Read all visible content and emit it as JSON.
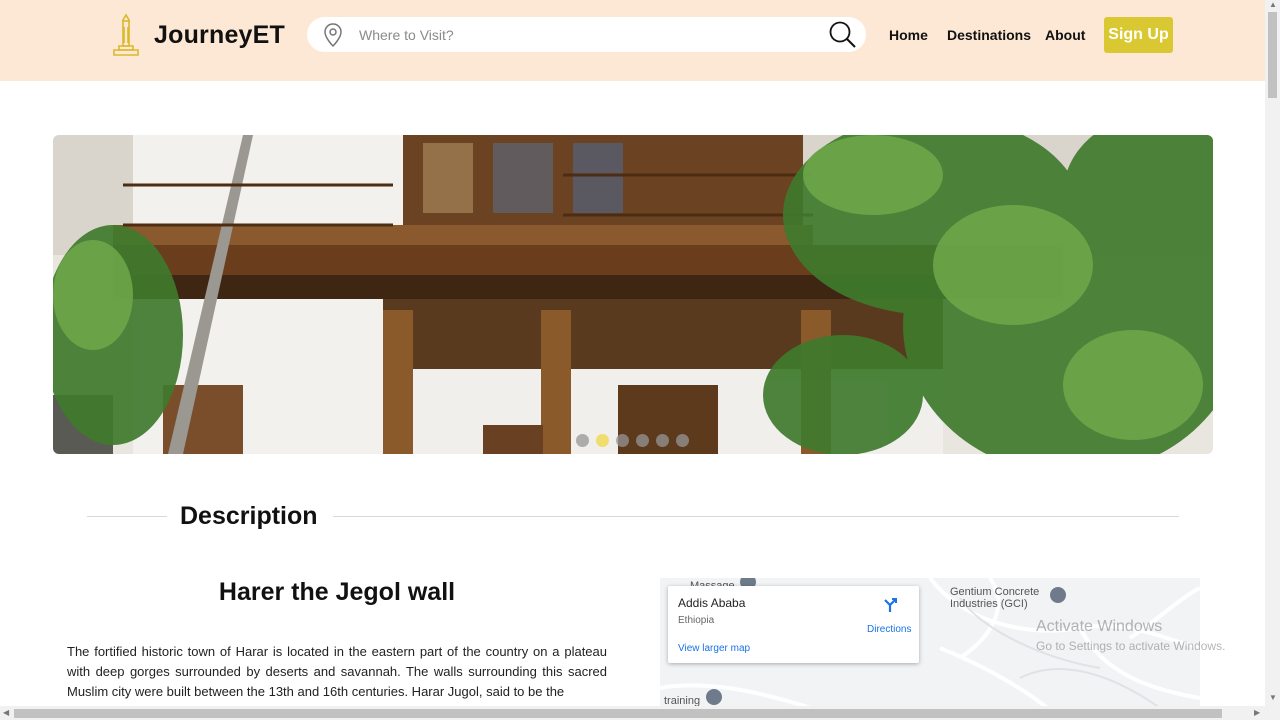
{
  "header": {
    "brand": "JourneyET",
    "search_placeholder": "Where to Visit?",
    "nav": [
      "Home",
      "Destinations",
      "About"
    ],
    "signup_label": "Sign Up",
    "background": "#fde8d5",
    "accent": "#d9c832"
  },
  "carousel": {
    "slide_count": 6,
    "active_index": 1,
    "active_dot_color": "#f1dd6d"
  },
  "description": {
    "heading": "Description",
    "title": "Harer the Jegol wall",
    "body": "The fortified historic town of Harar is located in the eastern part of the country on a plateau with deep gorges surrounded by deserts and savannah. The walls surrounding this sacred Muslim city were built between the 13th and 16th centuries. Harar Jugol, said to be the"
  },
  "map": {
    "city": "Addis Ababa",
    "country": "Ethiopia",
    "directions": "Directions",
    "view_larger": "View larger map",
    "labels": [
      "Massage",
      "Gentium Concrete Industries (GCI)",
      "training"
    ]
  },
  "overlay": {
    "watermark_title": "Activate Windows",
    "watermark_sub": "Go to Settings to activate Windows."
  }
}
